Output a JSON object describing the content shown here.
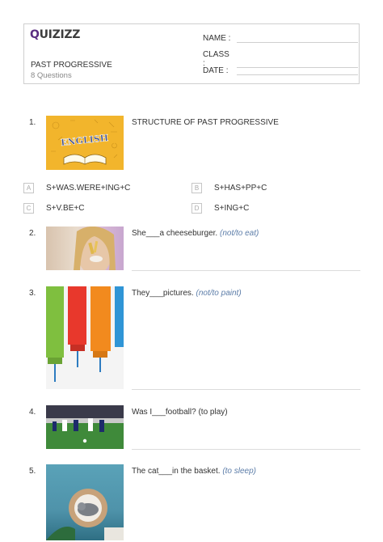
{
  "header": {
    "logo": "QUIZIZZ",
    "title": "PAST PROGRESSIVE",
    "subtitle": "8 Questions",
    "fields": [
      {
        "label": "NAME :"
      },
      {
        "label": "CLASS :"
      },
      {
        "label": "DATE  :"
      }
    ]
  },
  "questions": [
    {
      "number": "1.",
      "text": "STRUCTURE OF PAST PROGRESSIVE",
      "image_text": "ENGLISH",
      "options": [
        {
          "letter": "A",
          "text": "S+WAS.WERE+ING+C"
        },
        {
          "letter": "B",
          "text": "S+HAS+PP+C"
        },
        {
          "letter": "C",
          "text": "S+V.BE+C"
        },
        {
          "letter": "D",
          "text": "S+ING+C"
        }
      ]
    },
    {
      "number": "2.",
      "text": "She___a cheeseburger.",
      "hint": "(not/to eat)"
    },
    {
      "number": "3.",
      "text": "They___pictures.",
      "hint": "(not/to paint)"
    },
    {
      "number": "4.",
      "text": "Was I___football? (to play)"
    },
    {
      "number": "5.",
      "text": "The cat___in the basket.",
      "hint": "(to sleep)"
    }
  ]
}
